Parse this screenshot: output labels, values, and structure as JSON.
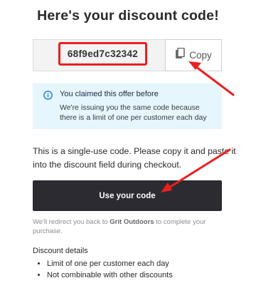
{
  "header": {
    "title": "Here's your discount code!"
  },
  "code": {
    "value": "68f9ed7c32342",
    "copy_label": "Copy"
  },
  "notice": {
    "title": "You claimed this offer before",
    "body": "We're issuing you the same code because there is a limit of one per customer each day"
  },
  "description": "This is a single-use code. Please copy it and paste it into the discount field during checkout.",
  "use_button": {
    "label": "Use your code"
  },
  "redirect": {
    "prefix": "We'll redirect you back to ",
    "store": "Grit Outdoors",
    "suffix": " to complete your purchase."
  },
  "details": {
    "title": "Discount details",
    "items": [
      "Limit of one per customer each day",
      "Not combinable with other discounts"
    ]
  },
  "colors": {
    "highlight": "#ea1f1f",
    "button": "#2b2b31",
    "notice_bg": "#e5f6fc",
    "info_icon": "#1b7fd6"
  }
}
